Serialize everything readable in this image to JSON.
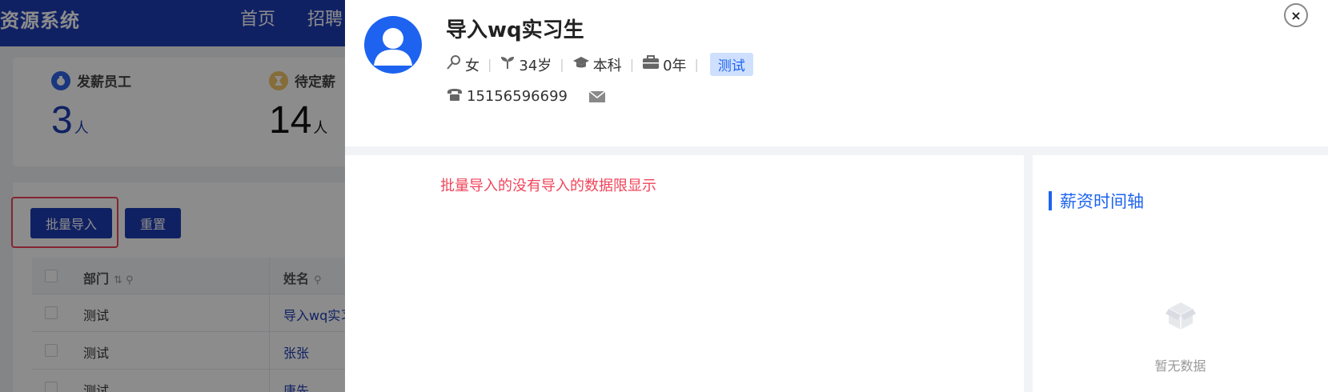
{
  "header": {
    "brand": "资源系统",
    "nav": [
      "首页",
      "招聘"
    ]
  },
  "stats": [
    {
      "label": "发薪员工",
      "value": "3",
      "unit": "人"
    },
    {
      "label": "待定薪",
      "value": "14",
      "unit": "人"
    }
  ],
  "actions": {
    "batch_import": "批量导入",
    "reset": "重置"
  },
  "table": {
    "columns": {
      "dept": "部门",
      "name": "姓名"
    },
    "rows": [
      {
        "dept": "测试",
        "name": "导入wq实习"
      },
      {
        "dept": "测试",
        "name": "张张"
      },
      {
        "dept": "测试",
        "name": "唐先"
      }
    ]
  },
  "drawer": {
    "employee": {
      "name": "导入wq实习生",
      "gender": "女",
      "age": "34岁",
      "education": "本科",
      "experience": "0年",
      "department": "测试",
      "phone": "15156596699"
    },
    "notice": "批量导入的没有导入的数据限显示",
    "timeline": {
      "title": "薪资时间轴",
      "empty": "暂无数据"
    },
    "close_label": "×"
  },
  "colors": {
    "primary": "#1e3db5",
    "accent": "#1d63f0",
    "danger": "#f0445a",
    "tag_bg": "#cfe0ff"
  }
}
